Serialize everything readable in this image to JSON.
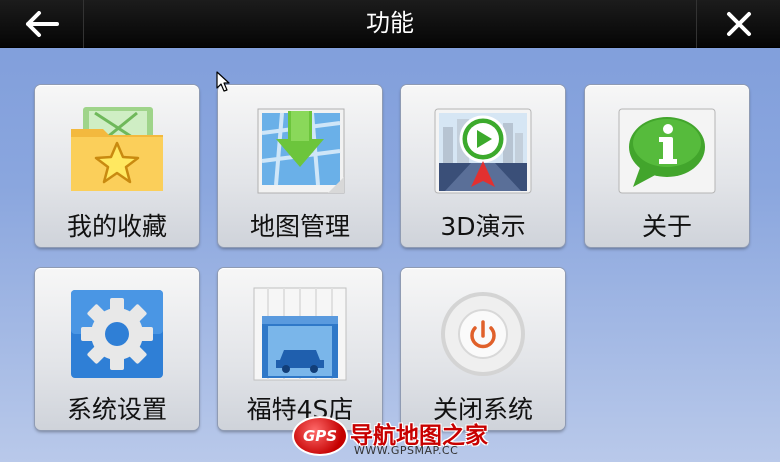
{
  "header": {
    "title": "功能",
    "back_icon": "arrow-left-icon",
    "close_icon": "close-icon"
  },
  "tiles": [
    {
      "label": "我的收藏",
      "icon": "favorites-folder-icon"
    },
    {
      "label": "地图管理",
      "icon": "map-download-icon"
    },
    {
      "label": "3D演示",
      "icon": "3d-demo-play-icon"
    },
    {
      "label": "关于",
      "icon": "info-bubble-icon"
    },
    {
      "label": "系统设置",
      "icon": "gear-icon"
    },
    {
      "label": "福特4S店",
      "icon": "dealership-garage-icon"
    },
    {
      "label": "关闭系统",
      "icon": "power-icon"
    }
  ],
  "watermark": {
    "badge": "GPS",
    "title": "导航地图之家",
    "url": "WWW.GPSMAP.CC"
  },
  "colors": {
    "background_top": "#7f9ddb",
    "background_bottom": "#b9c9ea",
    "topbar": "#0a0a0a",
    "watermark_red": "#c80000"
  }
}
